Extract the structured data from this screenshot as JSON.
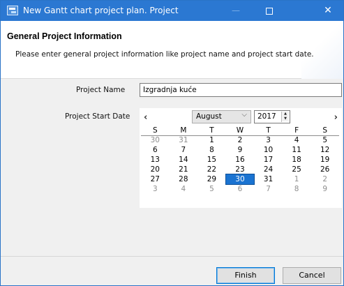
{
  "window": {
    "title": "New Gantt chart project plan. Project",
    "min_glyph": "—",
    "close_glyph": "✕"
  },
  "header": {
    "title": "General Project Information",
    "description": "Please enter general project information like project name and project start date."
  },
  "form": {
    "project_name_label": "Project Name",
    "project_name_value": "Izgradnja kuće",
    "start_date_label": "Project Start Date"
  },
  "calendar": {
    "prev_glyph": "‹",
    "next_glyph": "›",
    "month": "August",
    "year": "2017",
    "weekdays": [
      "S",
      "M",
      "T",
      "W",
      "T",
      "F",
      "S"
    ],
    "weeks": [
      [
        "30",
        "31",
        "1",
        "2",
        "3",
        "4",
        "5"
      ],
      [
        "6",
        "7",
        "8",
        "9",
        "10",
        "11",
        "12"
      ],
      [
        "13",
        "14",
        "15",
        "16",
        "17",
        "18",
        "19"
      ],
      [
        "20",
        "21",
        "22",
        "23",
        "24",
        "25",
        "26"
      ],
      [
        "27",
        "28",
        "29",
        "30",
        "31",
        "1",
        "2"
      ],
      [
        "3",
        "4",
        "5",
        "6",
        "7",
        "8",
        "9"
      ]
    ],
    "selected_day": "30"
  },
  "buttons": {
    "finish": "Finish",
    "cancel": "Cancel"
  }
}
